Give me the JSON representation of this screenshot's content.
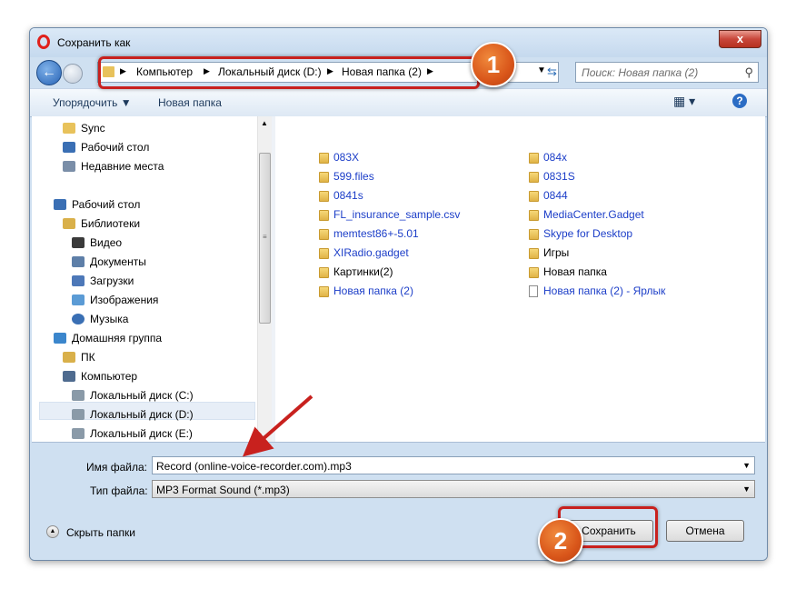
{
  "window": {
    "title": "Сохранить как",
    "close_label": "x"
  },
  "address": {
    "crumbs": [
      "Компьютер",
      "Локальный диск (D:)",
      "Новая папка (2)"
    ],
    "search_placeholder": "Поиск: Новая папка (2)"
  },
  "toolbar": {
    "organize_label": "Упорядочить ▼",
    "new_folder_label": "Новая папка"
  },
  "nav_tree": [
    {
      "label": "Sync",
      "icon": "folder-icon"
    },
    {
      "label": "Рабочий стол",
      "icon": "desktop-icon"
    },
    {
      "label": "Недавние места",
      "icon": "recent-places-icon"
    },
    {
      "label": "Рабочий стол",
      "icon": "desktop-icon"
    },
    {
      "label": "Библиотеки",
      "icon": "libraries-icon"
    },
    {
      "label": "Видео",
      "icon": "video-icon"
    },
    {
      "label": "Документы",
      "icon": "documents-icon"
    },
    {
      "label": "Загрузки",
      "icon": "downloads-icon"
    },
    {
      "label": "Изображения",
      "icon": "pictures-icon"
    },
    {
      "label": "Музыка",
      "icon": "music-icon"
    },
    {
      "label": "Домашняя группа",
      "icon": "homegroup-icon"
    },
    {
      "label": "ПК",
      "icon": "pc-icon"
    },
    {
      "label": "Компьютер",
      "icon": "computer-icon"
    },
    {
      "label": "Локальный диск (C:)",
      "icon": "drive-icon"
    },
    {
      "label": "Локальный диск (D:)",
      "icon": "drive-icon",
      "selected": true
    },
    {
      "label": "Локальный диск (E:)",
      "icon": "drive-icon"
    }
  ],
  "files_col1": [
    {
      "label": "083X",
      "type": "folder"
    },
    {
      "label": "599.files",
      "type": "folder"
    },
    {
      "label": "0841s",
      "type": "folder"
    },
    {
      "label": "FL_insurance_sample.csv",
      "type": "folder"
    },
    {
      "label": "memtest86+-5.01",
      "type": "folder"
    },
    {
      "label": "XIRadio.gadget",
      "type": "folder"
    },
    {
      "label": "Картинки(2)",
      "type": "folder"
    },
    {
      "label": "Новая папка (2)",
      "type": "folder"
    }
  ],
  "files_col2": [
    {
      "label": "084x",
      "type": "folder"
    },
    {
      "label": "0831S",
      "type": "folder"
    },
    {
      "label": "0844",
      "type": "folder"
    },
    {
      "label": "MediaCenter.Gadget",
      "type": "folder"
    },
    {
      "label": "Skype for Desktop",
      "type": "folder"
    },
    {
      "label": "Игры",
      "type": "folder"
    },
    {
      "label": "Новая папка",
      "type": "folder"
    },
    {
      "label": "Новая папка (2) - Ярлык",
      "type": "shortcut"
    }
  ],
  "form": {
    "filename_label": "Имя файла:",
    "filename_value": "Record (online-voice-recorder.com).mp3",
    "filetype_label": "Тип файла:",
    "filetype_value": "MP3 Format Sound (*.mp3)",
    "hide_folders_label": "Скрыть папки",
    "save_label": "Сохранить",
    "cancel_label": "Отмена"
  },
  "annotations": {
    "badge1": "1",
    "badge2": "2"
  },
  "colors": {
    "accent_red": "#c8211e",
    "badge_orange": "#d9561a",
    "link_blue": "#1c3ec8"
  }
}
